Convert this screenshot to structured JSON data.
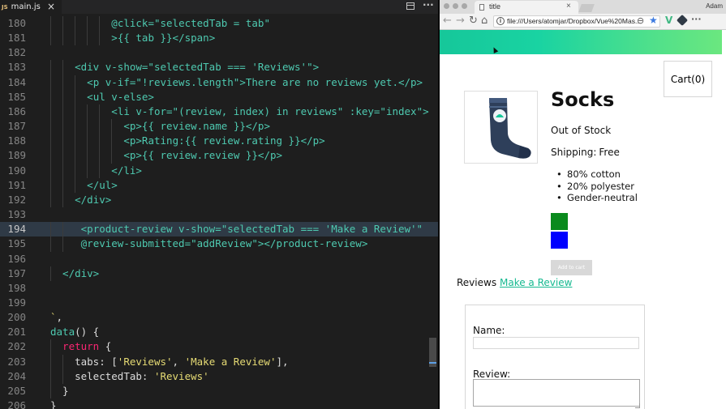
{
  "editor": {
    "file_badge": "JS",
    "file_name": "main.js",
    "close_glyph": "×",
    "more_glyph": "···",
    "lines": [
      {
        "n": "180",
        "indent": 10,
        "segs": [
          [
            "t",
            "@click=\"selectedTab = tab\""
          ]
        ]
      },
      {
        "n": "181",
        "indent": 10,
        "segs": [
          [
            "t",
            ">{{ tab }}</span>"
          ]
        ]
      },
      {
        "n": "182",
        "indent": 0,
        "segs": []
      },
      {
        "n": "183",
        "indent": 4,
        "segs": [
          [
            "t",
            "<div v-show=\"selectedTab === 'Reviews'\">"
          ]
        ]
      },
      {
        "n": "184",
        "indent": 6,
        "segs": [
          [
            "t",
            "<p v-if=\"!reviews.length\">There are no reviews yet.</p>"
          ]
        ]
      },
      {
        "n": "185",
        "indent": 6,
        "segs": [
          [
            "t",
            "<ul v-else>"
          ]
        ]
      },
      {
        "n": "186",
        "indent": 10,
        "segs": [
          [
            "t",
            "<li v-for=\"(review, index) in reviews\" :key=\"index\">"
          ]
        ]
      },
      {
        "n": "187",
        "indent": 12,
        "segs": [
          [
            "t",
            "<p>{{ review.name }}</p>"
          ]
        ]
      },
      {
        "n": "188",
        "indent": 12,
        "segs": [
          [
            "t",
            "<p>Rating:{{ review.rating }}</p>"
          ]
        ]
      },
      {
        "n": "189",
        "indent": 12,
        "segs": [
          [
            "t",
            "<p>{{ review.review }}</p>"
          ]
        ]
      },
      {
        "n": "190",
        "indent": 10,
        "segs": [
          [
            "t",
            "</li>"
          ]
        ]
      },
      {
        "n": "191",
        "indent": 6,
        "segs": [
          [
            "t",
            "</ul>"
          ]
        ]
      },
      {
        "n": "192",
        "indent": 4,
        "segs": [
          [
            "t",
            "</div>"
          ]
        ]
      },
      {
        "n": "193",
        "indent": 0,
        "segs": []
      },
      {
        "n": "194",
        "indent": 5,
        "hl": true,
        "segs": [
          [
            "t",
            "<product-review v-show=\"selectedTab === 'Make a Review'\""
          ]
        ]
      },
      {
        "n": "195",
        "indent": 5,
        "segs": [
          [
            "t",
            "@review-submitted=\"addReview\"></product-review>"
          ]
        ]
      },
      {
        "n": "196",
        "indent": 0,
        "segs": []
      },
      {
        "n": "197",
        "indent": 2,
        "segs": [
          [
            "t",
            "</div>"
          ]
        ]
      },
      {
        "n": "198",
        "indent": 0,
        "segs": []
      },
      {
        "n": "199",
        "indent": 0,
        "segs": []
      },
      {
        "n": "200",
        "indent": 0,
        "segs": [
          [
            "s",
            "`"
          ],
          [
            "w",
            ","
          ]
        ]
      },
      {
        "n": "201",
        "indent": 0,
        "segs": [
          [
            "t",
            "data"
          ],
          [
            "w",
            "() {"
          ]
        ]
      },
      {
        "n": "202",
        "indent": 2,
        "segs": [
          [
            "k",
            "return"
          ],
          [
            "w",
            " {"
          ]
        ]
      },
      {
        "n": "203",
        "indent": 4,
        "segs": [
          [
            "w",
            "tabs: ["
          ],
          [
            "s",
            "'Reviews'"
          ],
          [
            "w",
            ", "
          ],
          [
            "s",
            "'Make a Review'"
          ],
          [
            "w",
            "],"
          ]
        ]
      },
      {
        "n": "204",
        "indent": 4,
        "segs": [
          [
            "w",
            "selectedTab: "
          ],
          [
            "s",
            "'Reviews'"
          ]
        ]
      },
      {
        "n": "205",
        "indent": 2,
        "segs": [
          [
            "w",
            "}"
          ]
        ]
      },
      {
        "n": "206",
        "indent": 0,
        "segs": [
          [
            "w",
            "}"
          ]
        ]
      }
    ]
  },
  "browser": {
    "tab_title": "title",
    "tab_close": "×",
    "profile_name": "Adam",
    "nav": {
      "back": "←",
      "forward": "→",
      "reload": "↻",
      "home": "⌂"
    },
    "url": "file:///Users/atomjar/Dropbox/Vue%20Mas...",
    "zoom_glyph": "⊖",
    "star_glyph": "★",
    "ext_vue_glyph": "V",
    "menu_glyph": "···",
    "info_glyph": "i"
  },
  "product": {
    "cart_label": "Cart(0)",
    "title": "Socks",
    "stock_status": "Out of Stock",
    "shipping_label": "Shipping:",
    "shipping_value": "Free",
    "details": [
      "80% cotton",
      "20% polyester",
      "Gender-neutral"
    ],
    "variant_colors": [
      "#0a8a1d",
      "#0000ff"
    ],
    "add_to_cart_label": "Add to cart",
    "add_to_cart_disabled": true,
    "tabs": [
      "Reviews",
      "Make a Review"
    ],
    "selected_tab": "Make a Review",
    "form": {
      "name_label": "Name:",
      "name_value": "",
      "review_label": "Review:",
      "review_value": ""
    }
  },
  "colors": {
    "accent_green": "#16b990",
    "nav_gradient_start": "#16c79a",
    "nav_gradient_end": "#6be77f"
  },
  "icons": [
    "split-editor-icon",
    "more-actions-icon",
    "back-icon",
    "forward-icon",
    "reload-icon",
    "home-icon",
    "info-icon",
    "zoom-icon",
    "star-icon",
    "vue-devtools-icon",
    "extension-icon",
    "menu-icon",
    "mouse-cursor-icon"
  ]
}
